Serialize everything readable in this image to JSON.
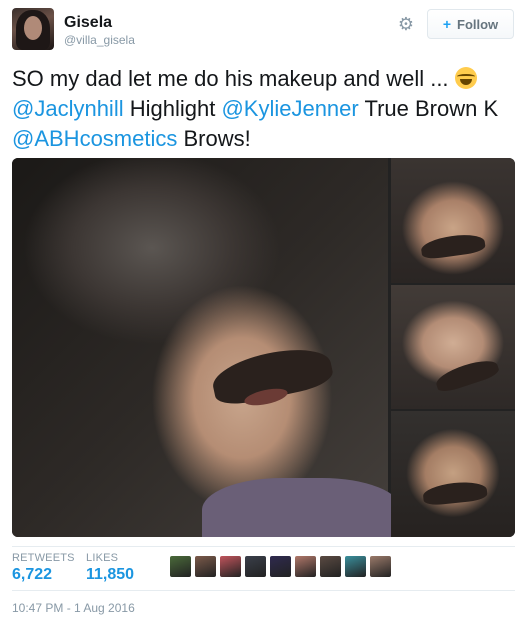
{
  "author": {
    "display_name": "Gisela",
    "screen_name": "@villa_gisela",
    "avatar_icon": "profile-photo"
  },
  "header": {
    "gear_icon": "gear-icon",
    "follow_icon_glyph": "+",
    "follow_label": "Follow"
  },
  "tweet": {
    "line1": "SO my dad let me do his makeup and well ...",
    "mention1": "@Jaclynhill",
    "text2": " Highlight ",
    "mention2": "@KylieJenner",
    "text3": " True Brown K",
    "mention3": "@ABHcosmetics",
    "text4": " Brows!",
    "emoji": "face-with-tears-of-joy"
  },
  "media": {
    "photo_count": 4
  },
  "stats": {
    "retweets_label": "RETWEETS",
    "retweets_value": "6,722",
    "likes_label": "LIKES",
    "likes_value": "11,850"
  },
  "likers": [
    {
      "color": "#4a6a3a"
    },
    {
      "color": "#7b5a4a"
    },
    {
      "color": "#c0545c"
    },
    {
      "color": "#3a3f4a"
    },
    {
      "color": "#2f2a4f"
    },
    {
      "color": "#b0786a"
    },
    {
      "color": "#5a4a42"
    },
    {
      "color": "#3a8f9c"
    },
    {
      "color": "#9a7a6a"
    }
  ],
  "timestamp": "10:47 PM - 1 Aug 2016",
  "colors": {
    "link": "#1b95e0",
    "muted": "#8899a6"
  }
}
